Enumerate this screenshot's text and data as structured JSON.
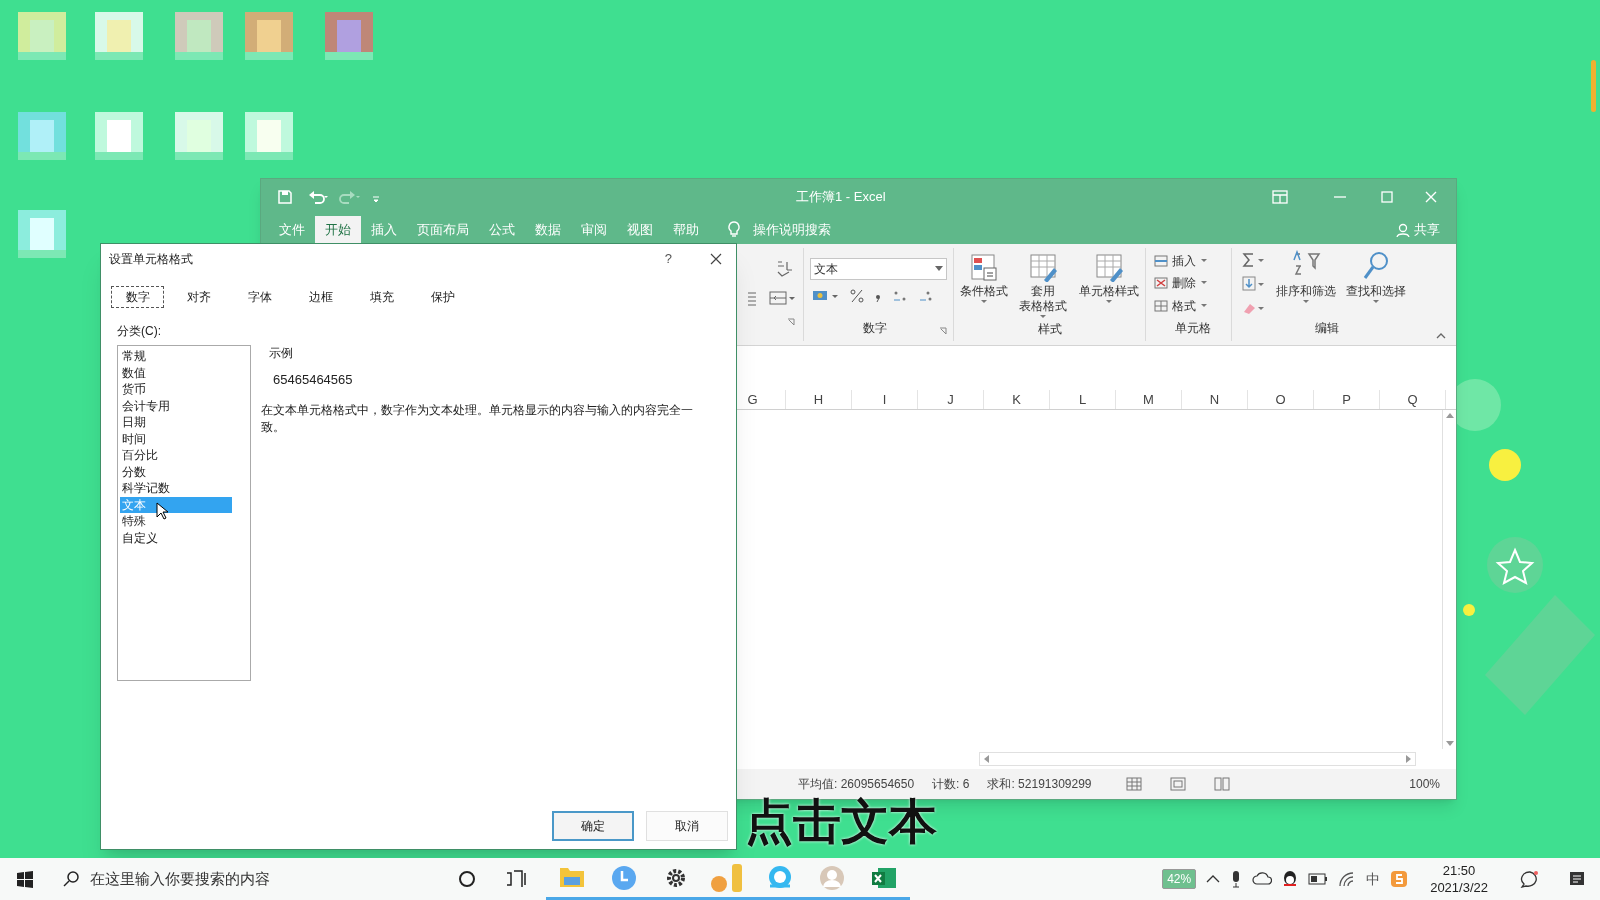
{
  "excel": {
    "title": "工作簿1 - Excel",
    "menu_tabs": [
      {
        "label": "文件",
        "selected": false
      },
      {
        "label": "开始",
        "selected": true
      },
      {
        "label": "插入",
        "selected": false
      },
      {
        "label": "页面布局",
        "selected": false
      },
      {
        "label": "公式",
        "selected": false
      },
      {
        "label": "数据",
        "selected": false
      },
      {
        "label": "审阅",
        "selected": false
      },
      {
        "label": "视图",
        "selected": false
      },
      {
        "label": "帮助",
        "selected": false
      }
    ],
    "tell_me": "操作说明搜索",
    "share": "共享",
    "number_format": "文本",
    "groups": [
      {
        "kind": "number",
        "label": "数字"
      },
      {
        "kind": "styles",
        "label": "样式",
        "buttons": [
          {
            "lines": [
              "条件格式"
            ]
          },
          {
            "lines": [
              "套用",
              "表格格式"
            ]
          },
          {
            "lines": [
              "单元格样式"
            ]
          }
        ]
      },
      {
        "kind": "cells",
        "label": "单元格",
        "buttons": [
          {
            "lines": [
              "插入"
            ]
          },
          {
            "lines": [
              "删除"
            ]
          },
          {
            "lines": [
              "格式"
            ]
          }
        ]
      },
      {
        "kind": "editing",
        "label": "编辑",
        "buttons": [
          {
            "lines": [
              "排序和筛选"
            ]
          },
          {
            "lines": [
              "查找和选择"
            ]
          }
        ]
      }
    ],
    "column_headers": [
      "G",
      "H",
      "I",
      "J",
      "K",
      "L",
      "M",
      "N",
      "O",
      "P",
      "Q"
    ],
    "status_items": [
      "平均值: 26095654650",
      "计数: 6",
      "求和: 52191309299"
    ],
    "zoom": "100%"
  },
  "dialog": {
    "title": "设置单元格格式",
    "help": "?",
    "tabs": [
      {
        "label": "数字",
        "selected": true
      },
      {
        "label": "对齐",
        "selected": false
      },
      {
        "label": "字体",
        "selected": false
      },
      {
        "label": "边框",
        "selected": false
      },
      {
        "label": "填充",
        "selected": false
      },
      {
        "label": "保护",
        "selected": false
      }
    ],
    "category_label": "分类(C):",
    "categories": [
      {
        "label": "常规",
        "selected": false
      },
      {
        "label": "数值",
        "selected": false
      },
      {
        "label": "货币",
        "selected": false
      },
      {
        "label": "会计专用",
        "selected": false
      },
      {
        "label": "日期",
        "selected": false
      },
      {
        "label": "时间",
        "selected": false
      },
      {
        "label": "百分比",
        "selected": false
      },
      {
        "label": "分数",
        "selected": false
      },
      {
        "label": "科学记数",
        "selected": false
      },
      {
        "label": "文本",
        "selected": true
      },
      {
        "label": "特殊",
        "selected": false
      },
      {
        "label": "自定义",
        "selected": false
      }
    ],
    "sample_label": "示例",
    "sample_value": "65465464565",
    "description": "在文本单元格格式中，数字作为文本处理。单元格显示的内容与输入的内容完全一致。",
    "buttons": [
      {
        "label": "确定",
        "focused": true
      },
      {
        "label": "取消",
        "focused": false
      }
    ]
  },
  "caption": "点击文本",
  "taskbar": {
    "search_placeholder": "在这里输入你要搜索的内容",
    "apps": [
      {
        "kind": "folder",
        "running": true
      },
      {
        "kind": "clock",
        "running": true
      },
      {
        "kind": "gear",
        "running": true
      },
      {
        "kind": "app",
        "running": true
      },
      {
        "kind": "browser",
        "running": true
      },
      {
        "kind": "avatar",
        "running": true
      },
      {
        "kind": "excel",
        "running": true
      }
    ],
    "battery_percent": "42%",
    "ime": "中",
    "time": "21:50",
    "date": "2021/3/22"
  }
}
